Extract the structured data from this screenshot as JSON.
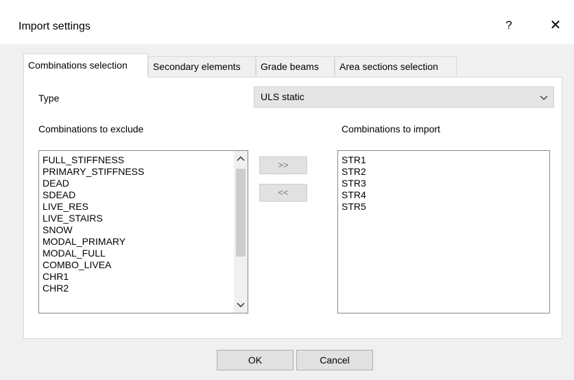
{
  "window": {
    "title": "Import settings",
    "help_glyph": "?",
    "close_glyph": "✕"
  },
  "tabs": [
    {
      "label": "Combinations selection",
      "active": true
    },
    {
      "label": "Secondary elements",
      "active": false
    },
    {
      "label": "Grade beams",
      "active": false
    },
    {
      "label": "Area sections selection",
      "active": false
    }
  ],
  "type_field": {
    "label": "Type",
    "value": "ULS static"
  },
  "exclude": {
    "label": "Combinations to exclude",
    "items": [
      "FULL_STIFFNESS",
      "PRIMARY_STIFFNESS",
      "DEAD",
      "SDEAD",
      "LIVE_RES",
      "LIVE_STAIRS",
      "SNOW",
      "MODAL_PRIMARY",
      "MODAL_FULL",
      "COMBO_LIVEA",
      "CHR1",
      "CHR2"
    ]
  },
  "import": {
    "label": "Combinations to import",
    "items": [
      "STR1",
      "STR2",
      "STR3",
      "STR4",
      "STR5"
    ]
  },
  "move_buttons": {
    "add": ">>",
    "remove": "<<"
  },
  "footer": {
    "ok": "OK",
    "cancel": "Cancel"
  },
  "icons": {
    "combo_arrow": "chevron-down-icon",
    "scroll_up": "chevron-up-icon",
    "scroll_down": "chevron-down-icon"
  }
}
